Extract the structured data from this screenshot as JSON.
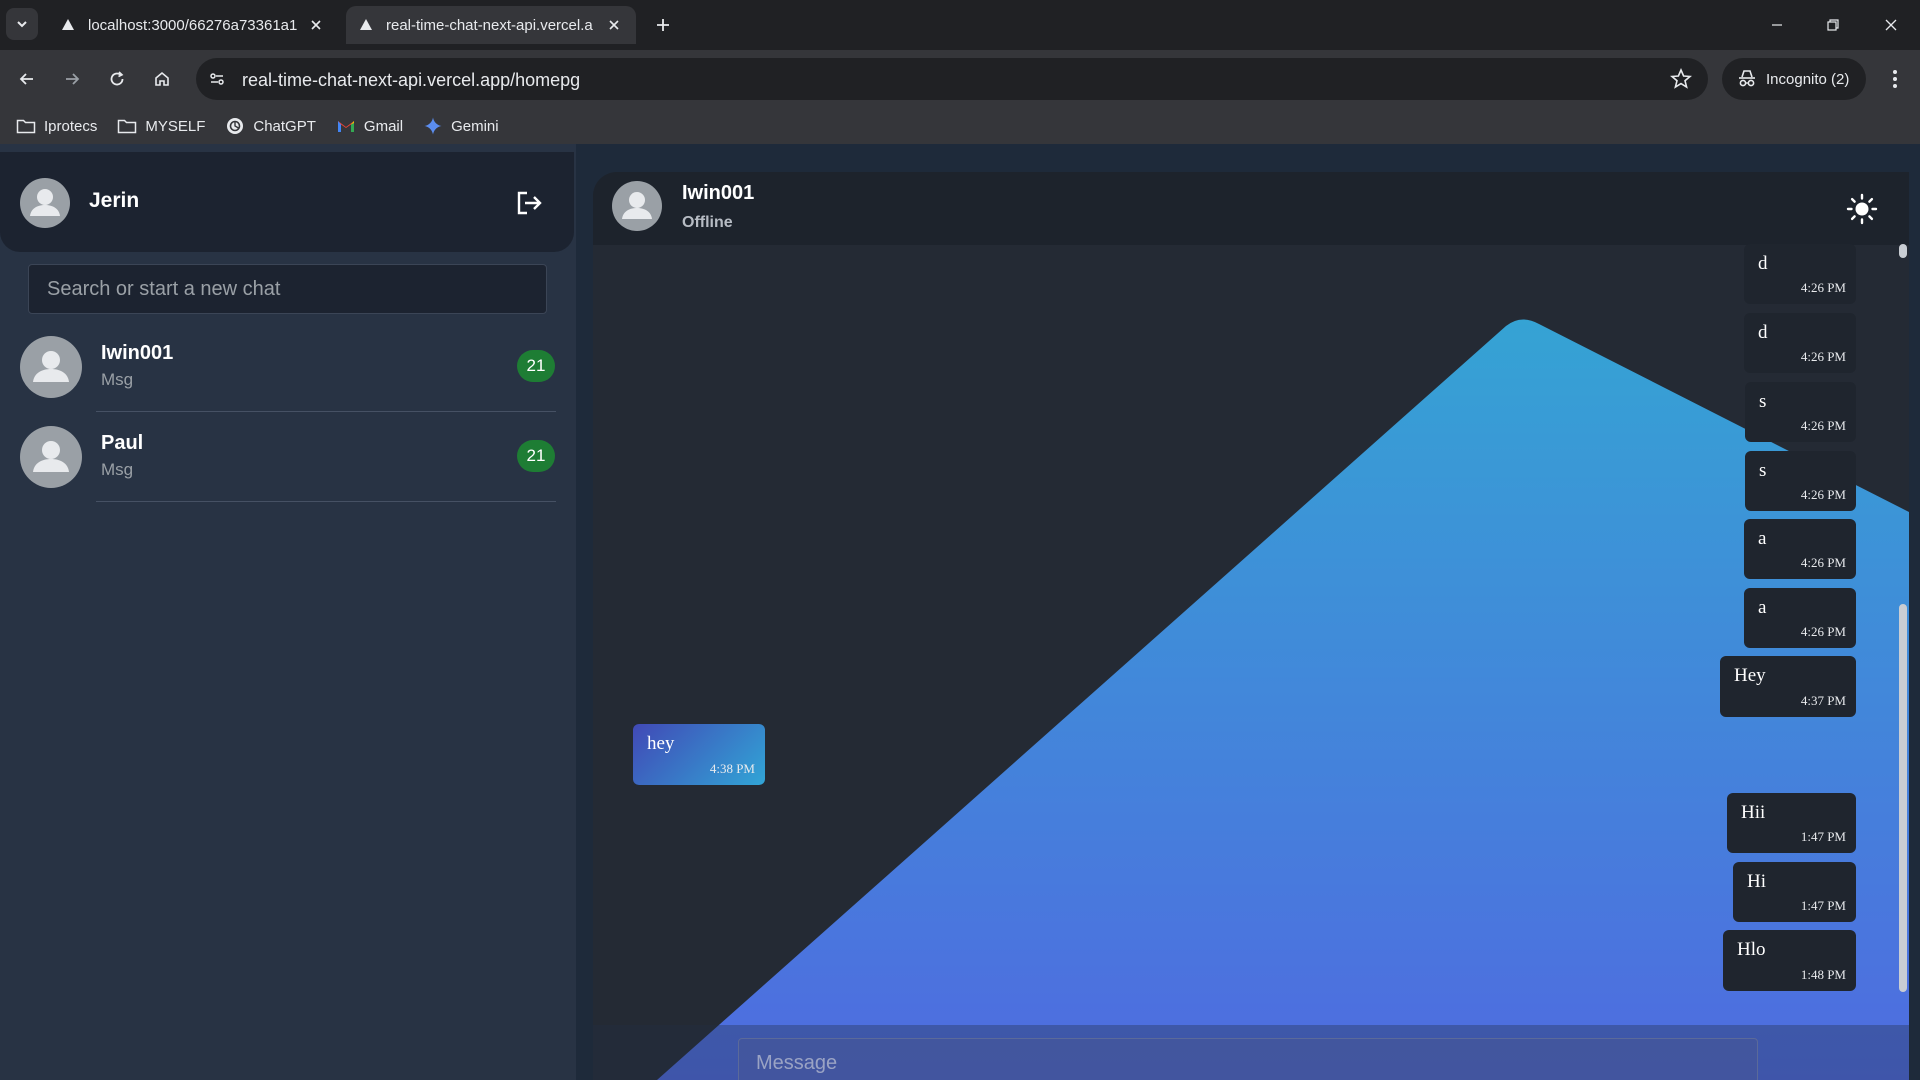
{
  "browser": {
    "tabs": [
      {
        "title": "localhost:3000/66276a73361a1",
        "active": false
      },
      {
        "title": "real-time-chat-next-api.vercel.a",
        "active": true
      }
    ],
    "url": "real-time-chat-next-api.vercel.app/homepg",
    "incognito_label": "Incognito (2)",
    "bookmarks": [
      {
        "label": "Iprotecs",
        "icon": "folder-icon"
      },
      {
        "label": "MYSELF",
        "icon": "folder-icon"
      },
      {
        "label": "ChatGPT",
        "icon": "chatgpt-icon"
      },
      {
        "label": "Gmail",
        "icon": "gmail-icon"
      },
      {
        "label": "Gemini",
        "icon": "gemini-icon"
      }
    ]
  },
  "sidebar": {
    "user_name": "Jerin",
    "search_placeholder": "Search or start a new chat",
    "contacts": [
      {
        "name": "Iwin001",
        "preview": "Msg",
        "unread": "21"
      },
      {
        "name": "Paul",
        "preview": "Msg",
        "unread": "21"
      }
    ]
  },
  "chat": {
    "peer_name": "Iwin001",
    "peer_status": "Offline",
    "messages": [
      {
        "text": "d",
        "time": "4:26 PM",
        "direction": "out"
      },
      {
        "text": "d",
        "time": "4:26 PM",
        "direction": "out"
      },
      {
        "text": "s",
        "time": "4:26 PM",
        "direction": "out"
      },
      {
        "text": "s",
        "time": "4:26 PM",
        "direction": "out"
      },
      {
        "text": "a",
        "time": "4:26 PM",
        "direction": "out"
      },
      {
        "text": "a",
        "time": "4:26 PM",
        "direction": "out"
      },
      {
        "text": "Hey",
        "time": "4:37 PM",
        "direction": "out"
      },
      {
        "text": "hey",
        "time": "4:38 PM",
        "direction": "in"
      },
      {
        "text": "Hii",
        "time": "1:47 PM",
        "direction": "out"
      },
      {
        "text": "Hi",
        "time": "1:47 PM",
        "direction": "out"
      },
      {
        "text": "Hlo",
        "time": "1:48 PM",
        "direction": "out"
      }
    ],
    "input_placeholder": "Message"
  },
  "colors": {
    "badge": "#1e7d34",
    "incoming_gradient_start": "#4149b6",
    "incoming_gradient_end": "#31a5d6",
    "background_gradient_start": "#35a3d4",
    "background_gradient_end": "#4f6be0"
  }
}
